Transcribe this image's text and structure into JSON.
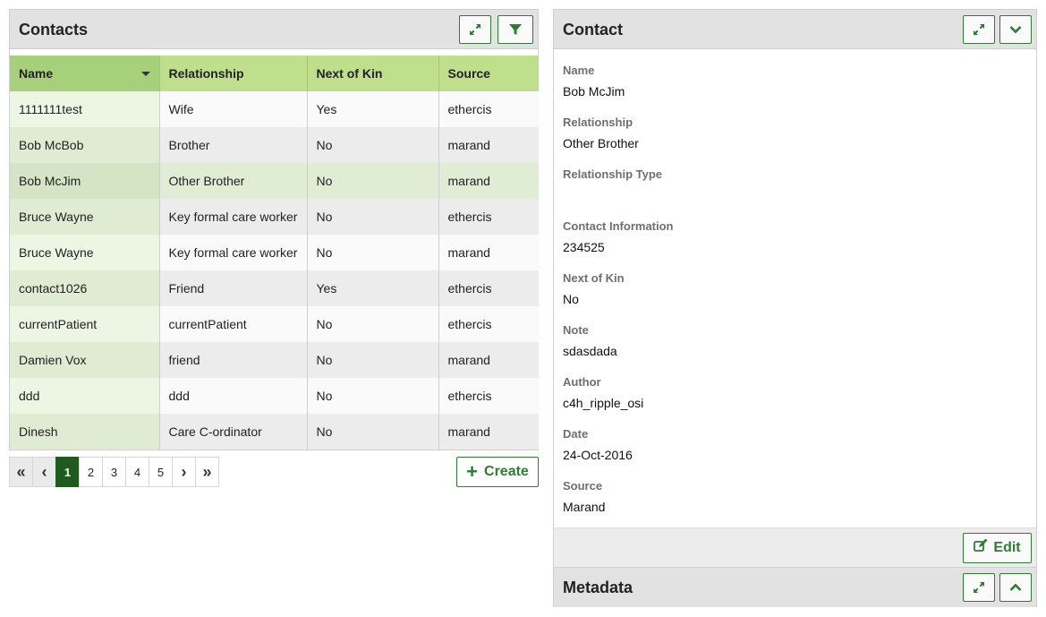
{
  "contacts_panel": {
    "title": "Contacts",
    "columns": [
      "Name",
      "Relationship",
      "Next of Kin",
      "Source"
    ],
    "rows": [
      [
        "1111111test",
        "Wife",
        "Yes",
        "ethercis"
      ],
      [
        "Bob McBob",
        "Brother",
        "No",
        "marand"
      ],
      [
        "Bob McJim",
        "Other Brother",
        "No",
        "marand"
      ],
      [
        "Bruce Wayne",
        "Key formal care worker",
        "No",
        "ethercis"
      ],
      [
        "Bruce Wayne",
        "Key formal care worker",
        "No",
        "marand"
      ],
      [
        "contact1026",
        "Friend",
        "Yes",
        "ethercis"
      ],
      [
        "currentPatient",
        "currentPatient",
        "No",
        "ethercis"
      ],
      [
        "Damien Vox",
        "friend",
        "No",
        "marand"
      ],
      [
        "ddd",
        "ddd",
        "No",
        "ethercis"
      ],
      [
        "Dinesh",
        "Care C-ordinator",
        "No",
        "marand"
      ]
    ],
    "selected_row_index": 2,
    "icons": {
      "expand": "expand-icon",
      "filter": "filter-icon",
      "sort": "sort-desc-icon"
    }
  },
  "pagination": {
    "first": "«",
    "prev": "‹",
    "pages": [
      "1",
      "2",
      "3",
      "4",
      "5"
    ],
    "active_page": "1",
    "next": "›",
    "last": "»"
  },
  "create_button": {
    "label": "Create",
    "icon": "plus-icon"
  },
  "contact_panel": {
    "title": "Contact",
    "fields": [
      {
        "label": "Name",
        "value": "Bob McJim"
      },
      {
        "label": "Relationship",
        "value": "Other Brother"
      },
      {
        "label": "Relationship Type",
        "value": ""
      },
      {
        "label": "Contact Information",
        "value": "234525"
      },
      {
        "label": "Next of Kin",
        "value": "No"
      },
      {
        "label": "Note",
        "value": "sdasdada"
      },
      {
        "label": "Author",
        "value": "c4h_ripple_osi"
      },
      {
        "label": "Date",
        "value": "24-Oct-2016"
      },
      {
        "label": "Source",
        "value": "Marand"
      }
    ],
    "edit_label": "Edit",
    "icons": {
      "expand": "expand-icon",
      "collapse": "chevron-down-icon",
      "edit": "edit-icon"
    }
  },
  "metadata_panel": {
    "title": "Metadata",
    "icons": {
      "expand": "expand-icon",
      "toggle": "chevron-up-icon"
    }
  },
  "colors": {
    "accent": "#2e7d32",
    "header_green": "#bfdf8c",
    "sorted_header_green": "#a7d07a",
    "active_page": "#1f5a1f",
    "panel_header": "#e2e2e2"
  }
}
